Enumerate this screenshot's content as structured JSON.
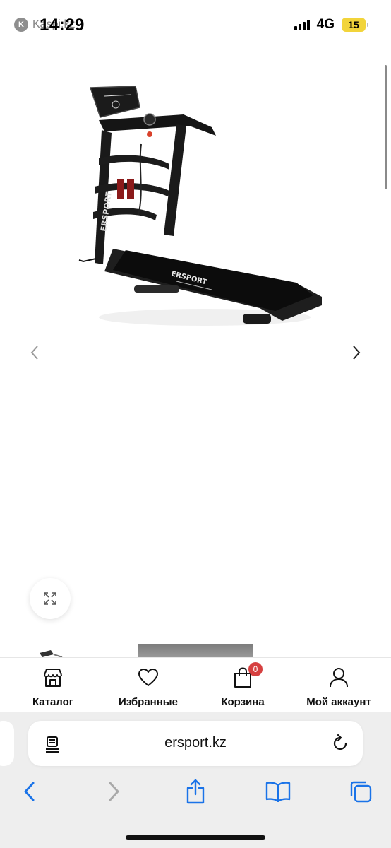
{
  "status_bar": {
    "back_app_label": "Kaspi.kz",
    "time": "14:29",
    "network": "4G",
    "battery": "15"
  },
  "gallery": {
    "product_alt": "ERSPORT treadmill",
    "brand_on_product": "ERSPORT"
  },
  "site_nav": {
    "catalog": "Каталог",
    "favorites": "Избранные",
    "cart": "Корзина",
    "cart_count": "0",
    "account": "Мой аккаунт"
  },
  "browser": {
    "url": "ersport.kz"
  },
  "colors": {
    "accent_blue": "#1a73e8",
    "badge_red": "#d64040",
    "battery_yellow": "#f2d43a"
  }
}
